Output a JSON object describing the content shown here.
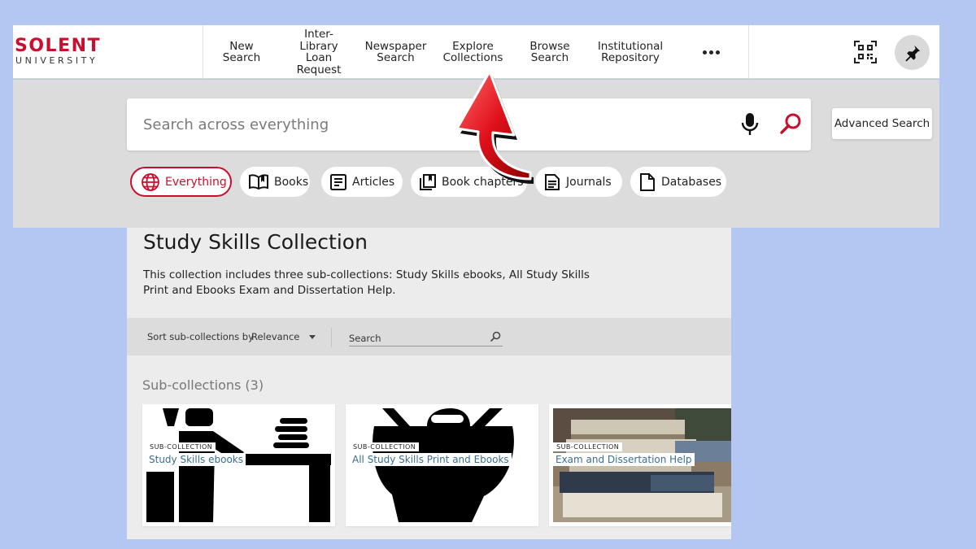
{
  "logo": {
    "line1": "SOLENT",
    "line2": "UNIVERSITY"
  },
  "nav": [
    {
      "label": "New\nSearch"
    },
    {
      "label": "Inter-\nLibrary\nLoan\nRequest"
    },
    {
      "label": "Newspaper\nSearch"
    },
    {
      "label": "Explore\nCollections"
    },
    {
      "label": "Browse\nSearch"
    },
    {
      "label": "Institutional\nRepository"
    }
  ],
  "header_icons": {
    "more": "more-dots-icon",
    "qr": "qr-code-icon",
    "pin": "pin-icon"
  },
  "search": {
    "placeholder": "Search across everything",
    "mic_icon": "microphone-icon",
    "search_icon": "magnifier-icon",
    "advanced_label": "Advanced Search"
  },
  "chips": [
    {
      "label": "Everything",
      "icon": "globe-icon",
      "active": true
    },
    {
      "label": "Books",
      "icon": "open-book-icon",
      "active": false
    },
    {
      "label": "Articles",
      "icon": "article-icon",
      "active": false
    },
    {
      "label": "Book chapters",
      "icon": "book-chapters-icon",
      "active": false
    },
    {
      "label": "Journals",
      "icon": "journal-icon",
      "active": false
    },
    {
      "label": "Databases",
      "icon": "document-icon",
      "active": false
    }
  ],
  "collection": {
    "title": "Study Skills Collection",
    "description": "This collection includes three sub-collections: Study Skills ebooks, All Study Skills Print and Ebooks Exam and Dissertation Help.",
    "sort_label": "Sort sub-collections by",
    "sort_value": "Relevance",
    "search_label": "Search",
    "subcollections_heading": "Sub-collections (3)",
    "cards": [
      {
        "tag": "SUB-COLLECTION",
        "name": "Study Skills ebooks",
        "image": "person-studying-at-desk"
      },
      {
        "tag": "SUB-COLLECTION",
        "name": "All Study Skills Print and Ebooks",
        "image": "head-with-books"
      },
      {
        "tag": "SUB-COLLECTION",
        "name": "Exam and Dissertation Help",
        "image": "stack-of-books-photo"
      }
    ]
  },
  "colors": {
    "brand_red": "#c8102e",
    "page_bg": "#b4c6f2",
    "band_bg": "#dcdcdc",
    "link_blue": "#3b6e8f"
  }
}
